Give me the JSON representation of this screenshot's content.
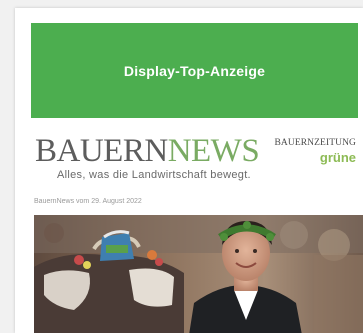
{
  "ad": {
    "label": "Display-Top-Anzeige"
  },
  "logo": {
    "part1": "BAUERN",
    "part2": "NEWS",
    "tagline": "Alles, was die Landwirtschaft bewegt."
  },
  "partner": {
    "top": "BAUERNZEITUNG",
    "bottom": "grüne"
  },
  "dateline": "BauernNews vom 29. August 2022",
  "colors": {
    "ad_green": "#4cae4f",
    "logo_gray": "#5d5d5d",
    "logo_green": "#7aab63",
    "page_bg": "#f1f1f1"
  }
}
